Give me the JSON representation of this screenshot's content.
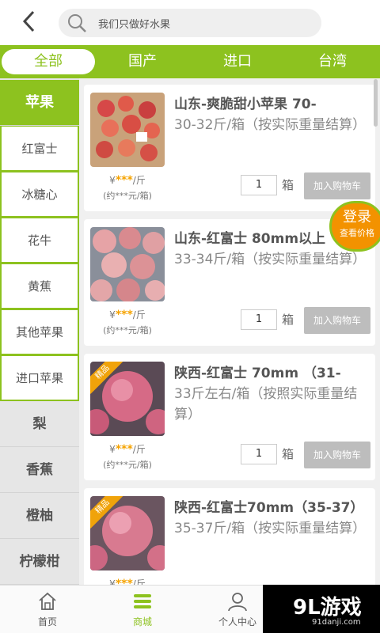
{
  "search": {
    "placeholder": "我们只做好水果"
  },
  "tabs": [
    "全部",
    "国产",
    "进口",
    "台湾"
  ],
  "categories": {
    "active_main": "苹果",
    "subs": [
      "红富士",
      "冰糖心",
      "花牛",
      "黄蕉",
      "其他苹果",
      "进口苹果"
    ],
    "mains": [
      "梨",
      "香蕉",
      "橙柚",
      "柠檬柑"
    ]
  },
  "products": [
    {
      "name_bold": "山东-爽脆甜小苹果 70-",
      "name_rest": "30-32斤/箱（按实际重量结算）",
      "price_stars": "***",
      "price_unit": "/斤",
      "price_prefix": "¥",
      "approx": "(约***元/箱)",
      "qty": "1",
      "unit": "箱",
      "add_label": "加入购物车",
      "badge": ""
    },
    {
      "name_bold": "山东-红富士 80mm以上",
      "name_rest": "33-34斤/箱（按实际重量结算）",
      "price_stars": "***",
      "price_unit": "/斤",
      "price_prefix": "¥",
      "approx": "(约***元/箱)",
      "qty": "1",
      "unit": "箱",
      "add_label": "加入购物车",
      "badge": ""
    },
    {
      "name_bold": "陕西-红富士 70mm （31-",
      "name_rest": "33斤左右/箱（按照实际重量结算）",
      "price_stars": "***",
      "price_unit": "/斤",
      "price_prefix": "¥",
      "approx": "(约***元/箱)",
      "qty": "1",
      "unit": "箱",
      "add_label": "加入购物车",
      "badge": "精品"
    },
    {
      "name_bold": "陕西-红富士70mm（35-37）",
      "name_rest": "35-37斤/箱（按实际重量结算）",
      "price_stars": "***",
      "price_unit": "/斤",
      "price_prefix": "¥",
      "approx": "",
      "qty": "",
      "unit": "",
      "add_label": "",
      "badge": "精品"
    }
  ],
  "login": {
    "title": "登录",
    "subtitle": "查看价格"
  },
  "bottom_nav": [
    {
      "label": "首页",
      "icon": "home-icon"
    },
    {
      "label": "商城",
      "icon": "menu-icon",
      "active": true
    },
    {
      "label": "个人中心",
      "icon": "user-icon"
    }
  ],
  "watermark": {
    "brand": "9L游戏",
    "url": "91danji.com"
  },
  "colors": {
    "accent": "#8dc21f",
    "orange": "#f39200",
    "star": "#f5a300"
  }
}
